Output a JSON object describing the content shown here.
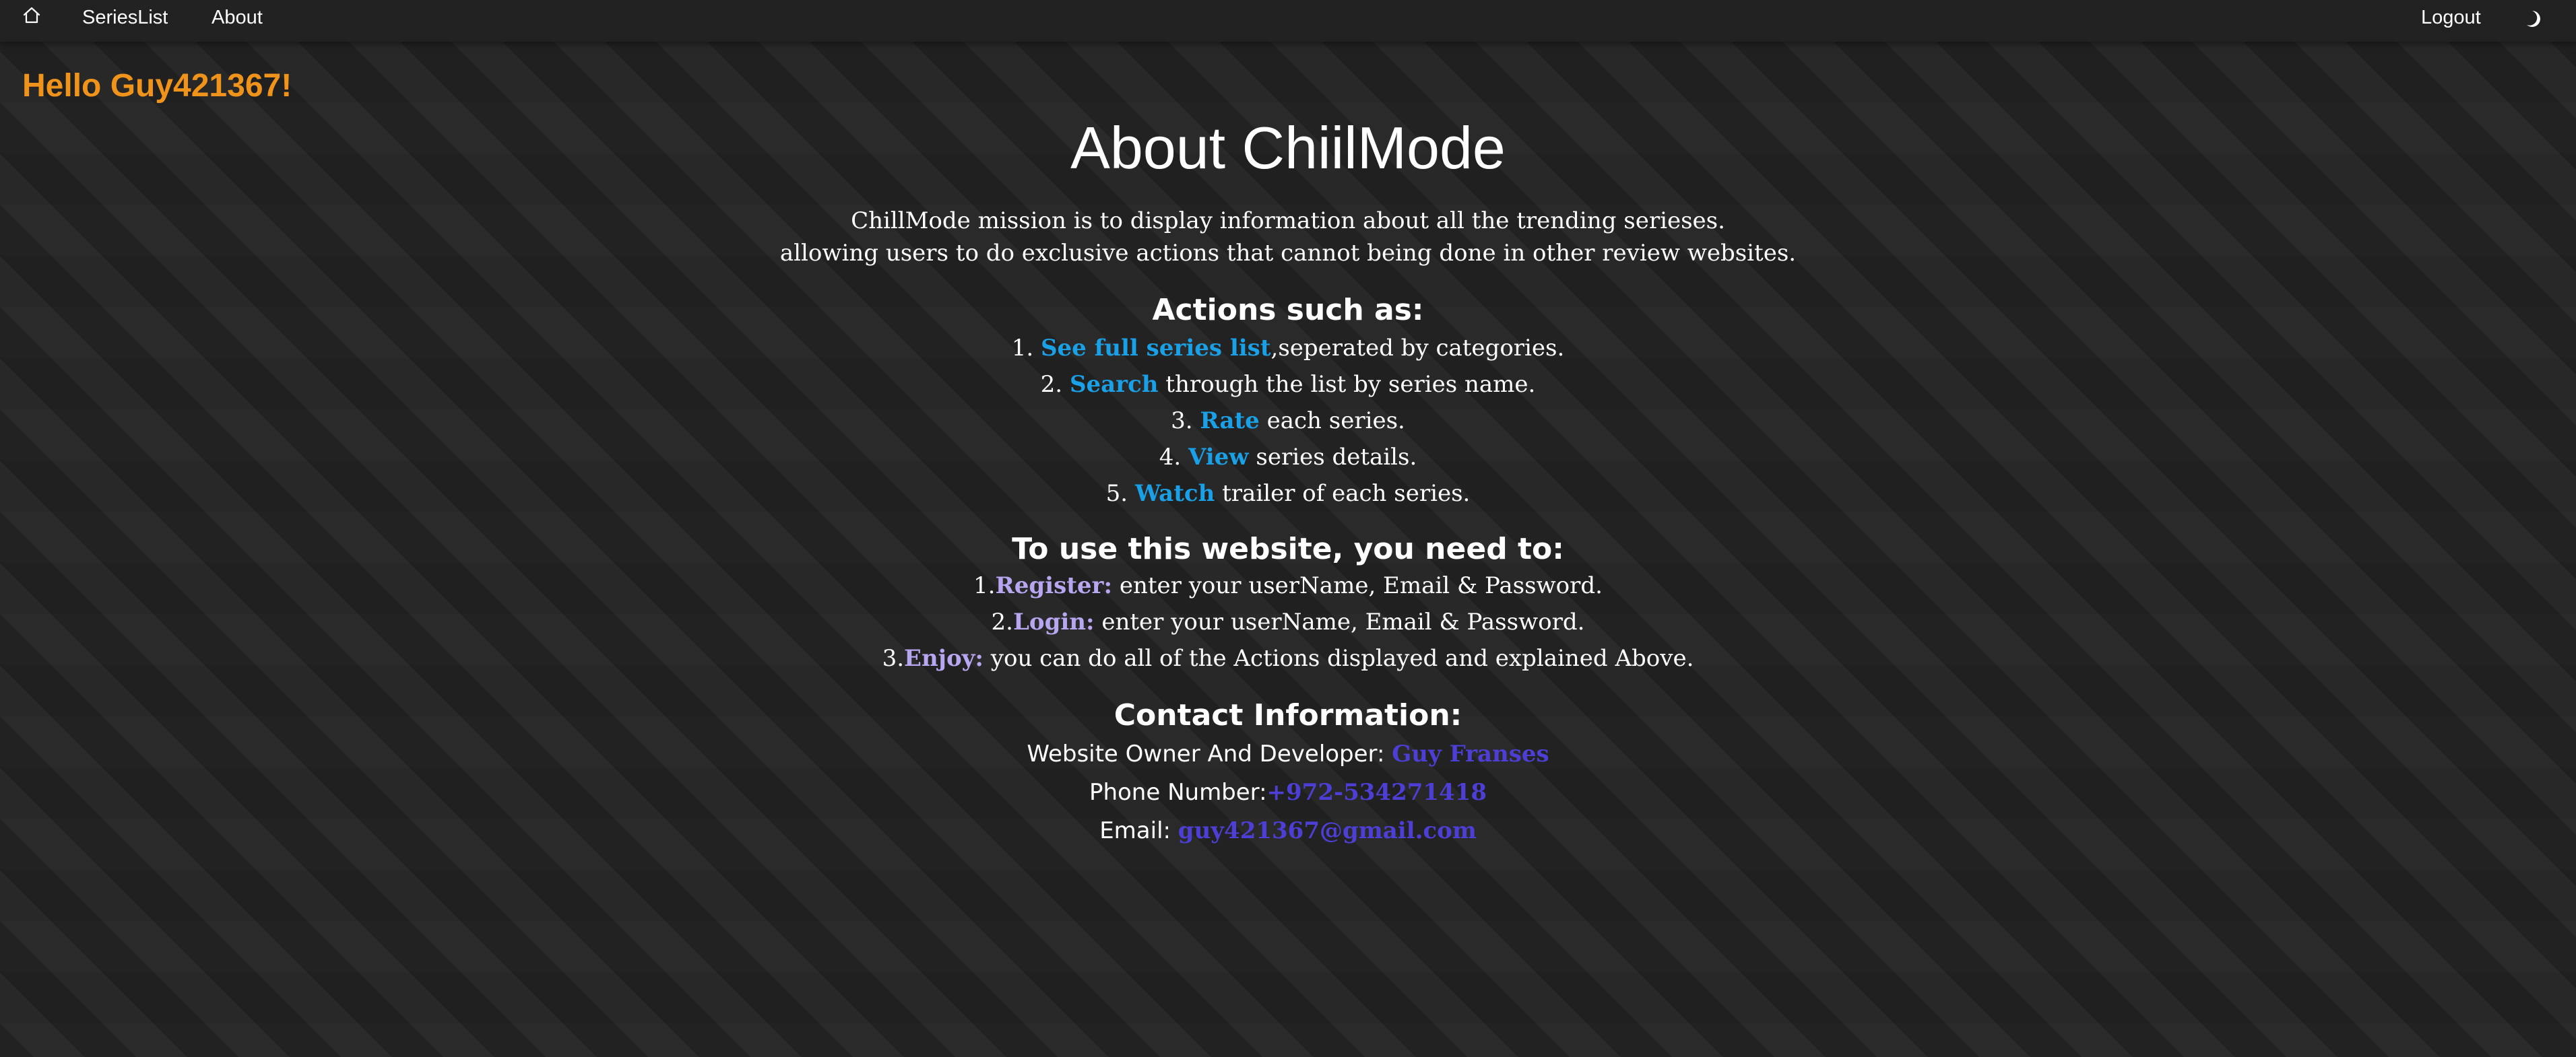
{
  "nav": {
    "home_icon": "home-icon",
    "series_list_label": "SeriesList",
    "about_label": "About",
    "logout_label": "Logout",
    "theme_icon": "moon-icon"
  },
  "greeting": "Hello Guy421367!",
  "about": {
    "title": "About ChiilMode",
    "intro": [
      "ChillMode mission is to display information about all the trending serieses.",
      "allowing users to do exclusive actions that cannot being done in other review websites."
    ],
    "actions_heading": "Actions such as:",
    "actions": [
      {
        "num": "1.",
        "link": "See full series list",
        "text": ",seperated by categories."
      },
      {
        "num": "2.",
        "link": "Search",
        "text": " through the list by series name."
      },
      {
        "num": "3.",
        "link": "Rate",
        "text": " each series."
      },
      {
        "num": "4.",
        "link": "View",
        "text": " series details."
      },
      {
        "num": "5.",
        "link": "Watch",
        "text": " trailer of each series."
      }
    ],
    "use_heading": "To use this website, you need to:",
    "steps": [
      {
        "num": "1.",
        "strong": "Register:",
        "text": " enter your userName, Email & Password."
      },
      {
        "num": "2.",
        "strong": "Login:",
        "text": " enter your userName, Email & Password."
      },
      {
        "num": "3.",
        "strong": "Enjoy:",
        "text": " you can do all of the Actions displayed and explained Above."
      }
    ],
    "contact_heading": "Contact Information:",
    "contact": {
      "owner_label": "Website Owner And Developer: ",
      "owner_value": "Guy Franses",
      "phone_label": "Phone Number:",
      "phone_value": "+972-534271418",
      "email_label": "Email: ",
      "email_value": "guy421367@gmail.com"
    }
  },
  "colors": {
    "background": "#222222",
    "greeting": "#f0931a",
    "action_link": "#1aa0e6",
    "step_label": "#b9a6f0",
    "contact_value": "#4d3fd6"
  }
}
